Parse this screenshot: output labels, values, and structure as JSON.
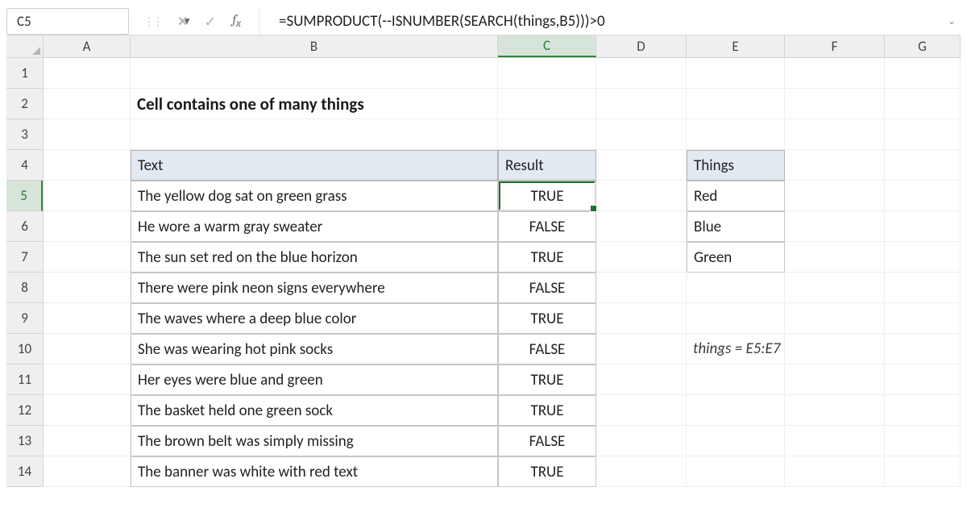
{
  "namebox": {
    "value": "C5"
  },
  "formula_bar": {
    "formula": "=SUMPRODUCT(--ISNUMBER(SEARCH(things,B5)))>0"
  },
  "columns": [
    "A",
    "B",
    "C",
    "D",
    "E",
    "F",
    "G"
  ],
  "rows": [
    "1",
    "2",
    "3",
    "4",
    "5",
    "6",
    "7",
    "8",
    "9",
    "10",
    "11",
    "12",
    "13",
    "14"
  ],
  "selected": {
    "col": "C",
    "row": "5"
  },
  "title": "Cell contains one of many things",
  "table": {
    "headers": {
      "text": "Text",
      "result": "Result"
    },
    "data": [
      {
        "text": "The yellow dog sat on green grass",
        "result": "TRUE"
      },
      {
        "text": "He wore a warm gray sweater",
        "result": "FALSE"
      },
      {
        "text": "The sun set red on the blue horizon",
        "result": "TRUE"
      },
      {
        "text": "There were pink neon signs everywhere",
        "result": "FALSE"
      },
      {
        "text": "The waves where a deep blue color",
        "result": "TRUE"
      },
      {
        "text": "She was wearing hot pink socks",
        "result": "FALSE"
      },
      {
        "text": "Her eyes were blue and green",
        "result": "TRUE"
      },
      {
        "text": "The basket held one green sock",
        "result": "TRUE"
      },
      {
        "text": "The brown belt was simply missing",
        "result": "FALSE"
      },
      {
        "text": "The banner was white with red text",
        "result": "TRUE"
      }
    ]
  },
  "things": {
    "header": "Things",
    "items": [
      "Red",
      "Blue",
      "Green"
    ]
  },
  "note": "things = E5:E7",
  "chart_data": {
    "type": "table",
    "title": "Cell contains one of many things",
    "columns": [
      "Text",
      "Result"
    ],
    "rows": [
      [
        "The yellow dog sat on green grass",
        "TRUE"
      ],
      [
        "He wore a warm gray sweater",
        "FALSE"
      ],
      [
        "The sun set red on the blue horizon",
        "TRUE"
      ],
      [
        "There were pink neon signs everywhere",
        "FALSE"
      ],
      [
        "The waves where a deep blue color",
        "TRUE"
      ],
      [
        "She was wearing hot pink socks",
        "FALSE"
      ],
      [
        "Her eyes were blue and green",
        "TRUE"
      ],
      [
        "The basket held one green sock",
        "TRUE"
      ],
      [
        "The brown belt was simply missing",
        "FALSE"
      ],
      [
        "The banner was white with red text",
        "TRUE"
      ]
    ],
    "lookup_table": {
      "header": "Things",
      "values": [
        "Red",
        "Blue",
        "Green"
      ],
      "range": "E5:E7"
    }
  }
}
